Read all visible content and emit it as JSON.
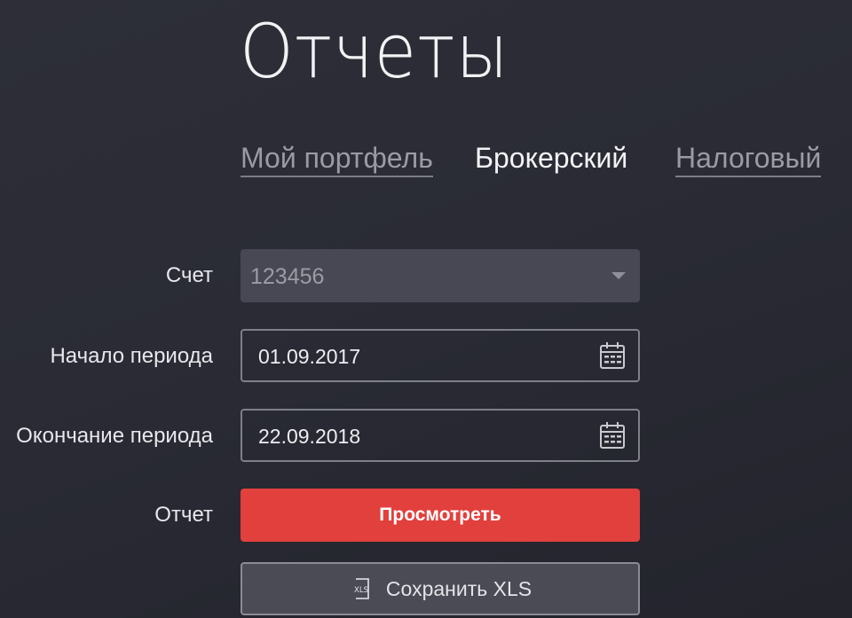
{
  "page": {
    "title": "Отчеты"
  },
  "tabs": [
    {
      "label": "Мой портфель",
      "active": false
    },
    {
      "label": "Брокерский",
      "active": true
    },
    {
      "label": "Налоговый",
      "active": false
    }
  ],
  "form": {
    "account": {
      "label": "Счет",
      "value": "123456",
      "icon": "chevron-down-icon"
    },
    "start": {
      "label": "Начало периода",
      "value": "01.09.2017",
      "icon": "calendar-icon"
    },
    "end": {
      "label": "Окончание периода",
      "value": "22.09.2018",
      "icon": "calendar-icon"
    },
    "report": {
      "label": "Отчет"
    }
  },
  "buttons": {
    "view_label": "Просмотреть",
    "save_label": "Сохранить XLS",
    "save_icon_text": "XLS"
  },
  "colors": {
    "background": "#2a2b35",
    "accent_red": "#e2403d",
    "select_bg": "#474853",
    "border": "#7e7f89"
  }
}
